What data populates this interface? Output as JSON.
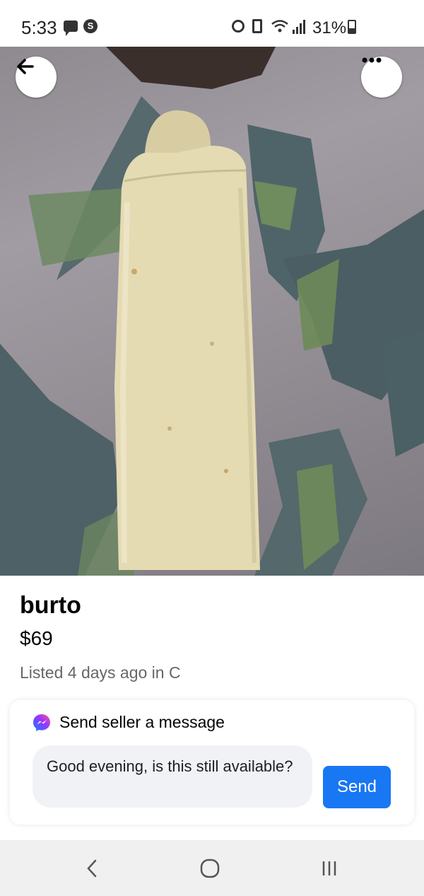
{
  "status_bar": {
    "time": "5:33",
    "battery_percent": "31%",
    "icons": [
      "chat-notification-icon",
      "s-app-icon",
      "alarm-icon",
      "battery-saver-icon",
      "wifi-icon",
      "signal-icon",
      "battery-icon"
    ]
  },
  "photo": {
    "description_icon": "burrito-photo",
    "back_icon": "arrow-left-icon",
    "more_icon": "more-dots-icon"
  },
  "listing": {
    "title": "burto",
    "price": "$69",
    "meta": "Listed 4 days ago in C"
  },
  "message": {
    "header_label": "Send seller a message",
    "input_value": "Good evening, is this still available?",
    "send_label": "Send",
    "accent_color": "#1877f2"
  },
  "nav_bar": {
    "icons": [
      "back-nav-icon",
      "home-nav-icon",
      "recent-apps-icon"
    ]
  }
}
